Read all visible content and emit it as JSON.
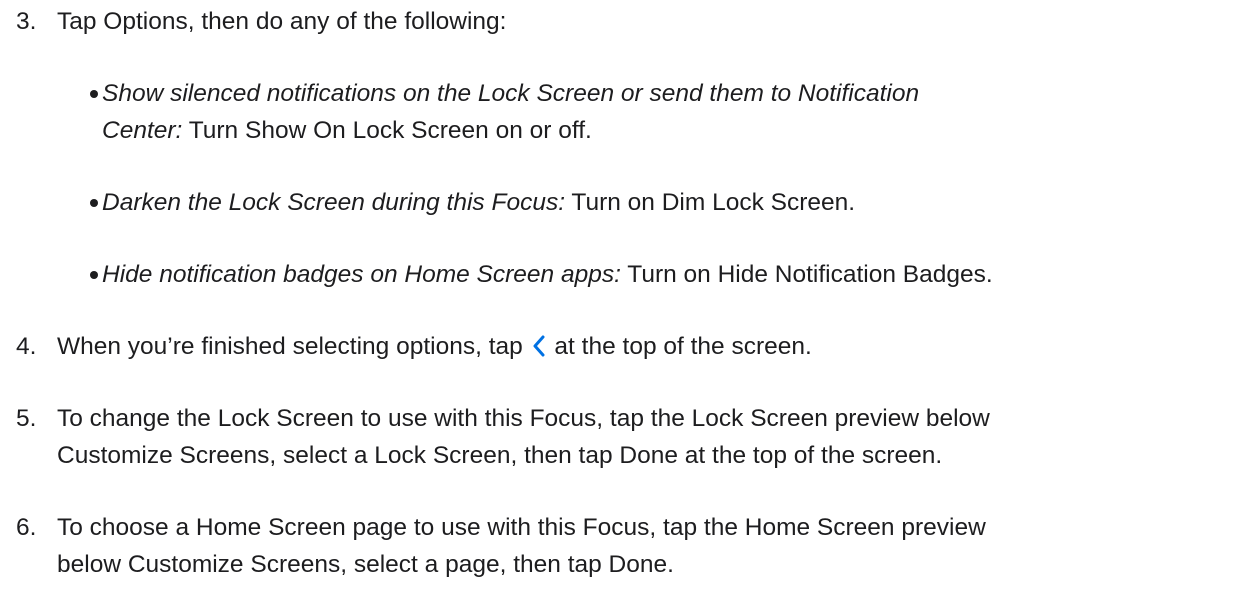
{
  "steps": [
    {
      "number": "3.",
      "text": "Tap Options, then do any of the following:"
    },
    {
      "number": "4.",
      "text_before": "When you’re finished selecting options, tap",
      "icon": "chevron-left-icon",
      "text_after": "at the top of the screen."
    },
    {
      "number": "5.",
      "lines": [
        "To change the Lock Screen to use with this Focus, tap the Lock Screen preview below",
        "Customize Screens, select a Lock Screen, then tap Done at the top of the screen."
      ]
    },
    {
      "number": "6.",
      "lines": [
        "To choose a Home Screen page to use with this Focus, tap the Home Screen preview",
        "below Customize Screens, select a page, then tap Done."
      ]
    }
  ],
  "bullets": [
    {
      "italic_lines": [
        "Show silenced notifications on the Lock Screen or send them to Notification",
        "Center:"
      ],
      "text": "Turn Show On Lock Screen on or off."
    },
    {
      "italic": "Darken the Lock Screen during this Focus:",
      "text": "Turn on Dim Lock Screen."
    },
    {
      "italic": "Hide notification badges on Home Screen apps:",
      "text": "Turn on Hide Notification Badges."
    }
  ],
  "colors": {
    "text": "#1d1d1f",
    "link_icon": "#0071e3"
  }
}
